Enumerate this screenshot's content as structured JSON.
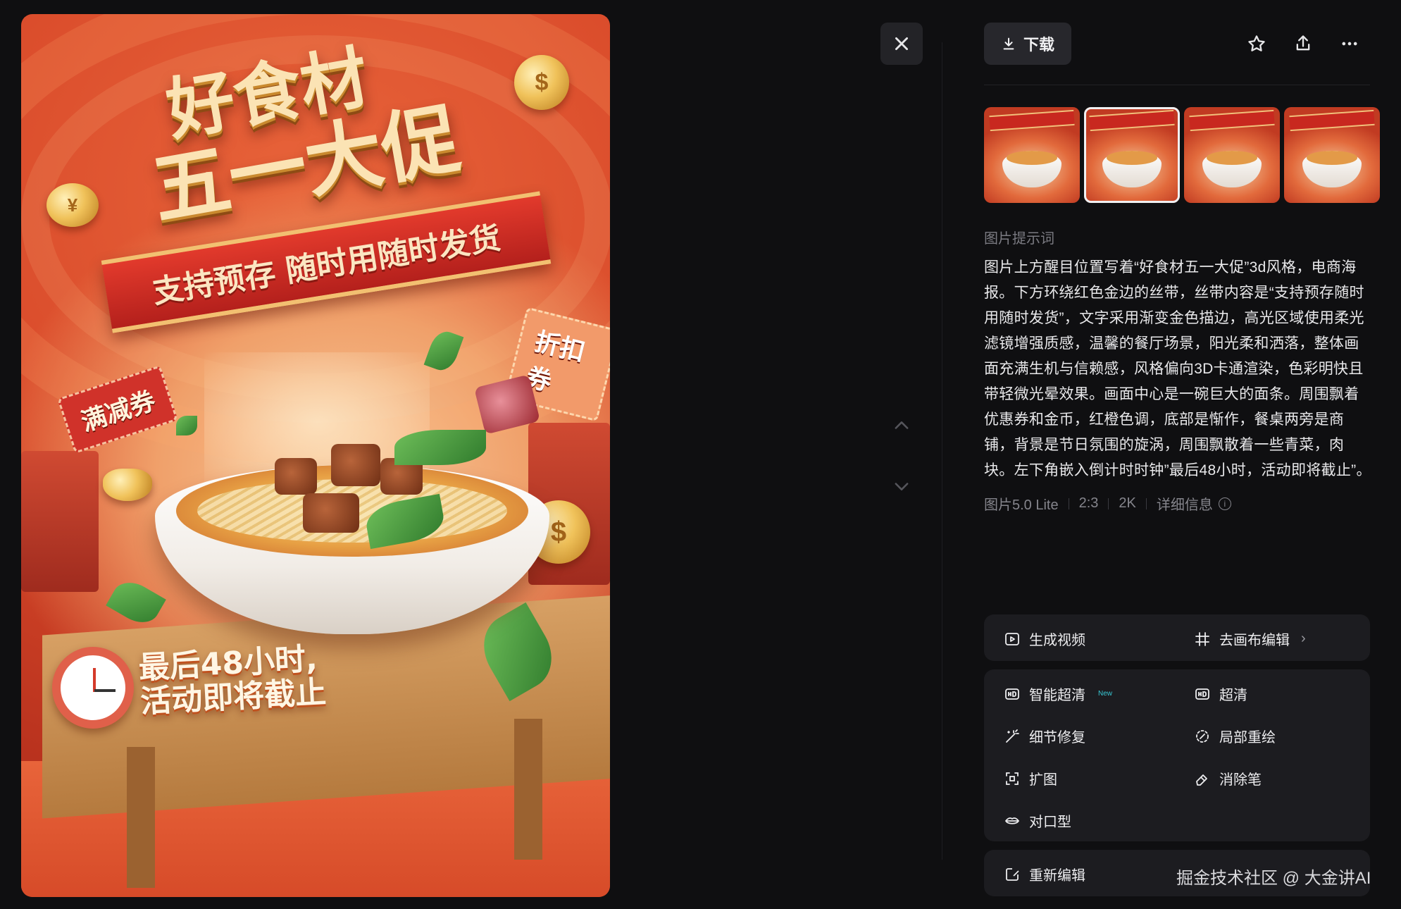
{
  "poster": {
    "headline_line1": "好食材",
    "headline_line2": "五一大促",
    "ribbon_text": "支持预存  随时用随时发货",
    "coupon_left": "满减券",
    "coupon_right": "折扣券",
    "countdown_line1": "最后48小时,",
    "countdown_line2": "活动即将截止"
  },
  "toolbar": {
    "download_label": "下载",
    "icons": [
      "star-icon",
      "share-icon",
      "more-icon"
    ]
  },
  "viewer": {
    "close_icon": "close-icon",
    "nav_icons": [
      "chevron-up-icon",
      "chevron-down-icon"
    ]
  },
  "thumbnails": {
    "count": 4,
    "selected_index": 1
  },
  "prompt": {
    "label": "图片提示词",
    "text": "图片上方醒目位置写着“好食材五一大促”3d风格，电商海报。下方环绕红色金边的丝带，丝带内容是“支持预存随时用随时发货”，文字采用渐变金色描边，高光区域使用柔光滤镜增强质感，温馨的餐厅场景，阳光柔和洒落，整体画面充满生机与信赖感，风格偏向3D卡通渲染，色彩明快且带轻微光晕效果。画面中心是一碗巨大的面条。周围飘着优惠券和金币，红橙色调，底部是惭作，餐桌两旁是商铺，背景是节日氛围的旋涡，周围飘散着一些青菜，肉块。左下角嵌入倒计时时钟”最后48小时，活动即将截止”。"
  },
  "meta": {
    "model": "图片5.0 Lite",
    "ratio": "2:3",
    "resolution": "2K",
    "details_label": "详细信息"
  },
  "actions": {
    "generate_video": "生成视频",
    "canvas_edit": "去画布编辑",
    "smart_upscale": "智能超清",
    "new_badge": "New",
    "upscale": "超清",
    "detail_fix": "细节修复",
    "inpaint": "局部重绘",
    "expand": "扩图",
    "eraser": "消除笔",
    "lip_sync": "对口型",
    "re_edit": "重新编辑"
  },
  "watermark": "掘金技术社区 @ 大金讲AI"
}
